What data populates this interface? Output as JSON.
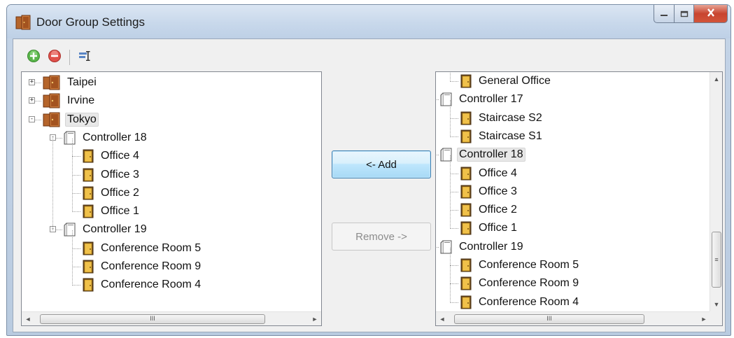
{
  "window": {
    "title": "Door Group Settings",
    "title_icon": "door-group-icon",
    "controls": {
      "minimize_icon": "minimize-icon",
      "maximize_icon": "maximize-icon",
      "close_icon": "close-icon"
    }
  },
  "toolbar": {
    "items": [
      {
        "icon": "add-green-circle-icon"
      },
      {
        "icon": "remove-red-circle-icon"
      },
      {
        "icon": "properties-icon"
      }
    ]
  },
  "left_tree": {
    "nodes": [
      {
        "label": "Taipei",
        "icon": "door-group-icon",
        "expander": "+"
      },
      {
        "label": "Irvine",
        "icon": "door-group-icon",
        "expander": "+"
      },
      {
        "label": "Tokyo",
        "icon": "door-group-icon",
        "expander": "-",
        "selected": true
      },
      {
        "label": "Controller 18",
        "icon": "controller-icon",
        "expander": "-"
      },
      {
        "label": "Office 4",
        "icon": "door-icon"
      },
      {
        "label": "Office 3",
        "icon": "door-icon"
      },
      {
        "label": "Office 2",
        "icon": "door-icon"
      },
      {
        "label": "Office 1",
        "icon": "door-icon"
      },
      {
        "label": "Controller 19",
        "icon": "controller-icon",
        "expander": "-"
      },
      {
        "label": "Conference Room 5",
        "icon": "door-icon"
      },
      {
        "label": "Conference Room 9",
        "icon": "door-icon"
      },
      {
        "label": "Conference Room 4",
        "icon": "door-icon"
      }
    ],
    "hscroll_grip": "III"
  },
  "right_tree": {
    "nodes": [
      {
        "label": "General Office",
        "icon": "door-icon"
      },
      {
        "label": "Controller 17",
        "icon": "controller-icon"
      },
      {
        "label": "Staircase S2",
        "icon": "door-icon"
      },
      {
        "label": "Staircase S1",
        "icon": "door-icon"
      },
      {
        "label": "Controller 18",
        "icon": "controller-icon",
        "selected": true
      },
      {
        "label": "Office 4",
        "icon": "door-icon"
      },
      {
        "label": "Office 3",
        "icon": "door-icon"
      },
      {
        "label": "Office 2",
        "icon": "door-icon"
      },
      {
        "label": "Office 1",
        "icon": "door-icon"
      },
      {
        "label": "Controller 19",
        "icon": "controller-icon"
      },
      {
        "label": "Conference Room 5",
        "icon": "door-icon"
      },
      {
        "label": "Conference Room 9",
        "icon": "door-icon"
      },
      {
        "label": "Conference Room 4",
        "icon": "door-icon"
      }
    ],
    "hscroll_grip": "III",
    "vscroll_grip": "≡"
  },
  "buttons": {
    "add_label": "<- Add",
    "remove_label": "Remove ->",
    "remove_enabled": false
  },
  "colors": {
    "accent": "#3c7fb1",
    "selection": "#e8e8e8",
    "disabled_text": "#8c8c8c",
    "close_button": "#c8442f"
  }
}
